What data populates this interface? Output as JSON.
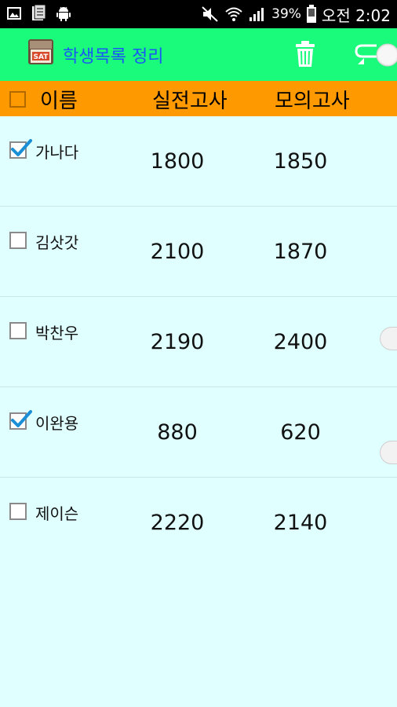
{
  "status_bar": {
    "battery_percent": "39%",
    "time": "오전 2:02",
    "icons": [
      "gallery-icon",
      "document-icon",
      "android-icon",
      "mute-icon",
      "wifi-icon",
      "signal-icon",
      "battery-icon"
    ]
  },
  "action_bar": {
    "title": "학생목록 정리",
    "app_icon_label": "SAT",
    "background": "#1afa7b",
    "title_color": "#1a57f5"
  },
  "header": {
    "name_label": "이름",
    "score1_label": "실전고사",
    "score2_label": "모의고사",
    "background": "#ff9900"
  },
  "students": [
    {
      "name": "가나다",
      "score1": "1800",
      "score2": "1850",
      "checked": true
    },
    {
      "name": "김삿갓",
      "score1": "2100",
      "score2": "1870",
      "checked": false
    },
    {
      "name": "박찬우",
      "score1": "2190",
      "score2": "2400",
      "checked": false
    },
    {
      "name": "이완용",
      "score1": "880",
      "score2": "620",
      "checked": true
    },
    {
      "name": "제이슨",
      "score1": "2220",
      "score2": "2140",
      "checked": false
    }
  ],
  "colors": {
    "list_background": "#e0ffff",
    "check_color": "#1a8fd6"
  }
}
